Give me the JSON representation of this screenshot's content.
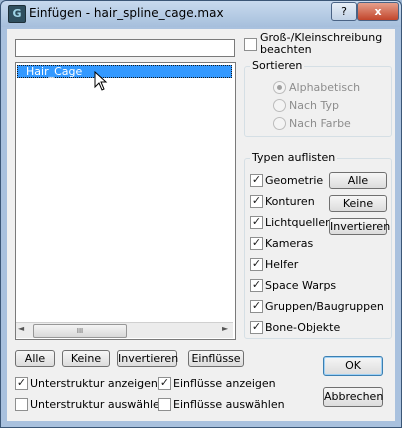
{
  "window": {
    "title": "Einfügen - hair_spline_cage.max"
  },
  "titlebar": {
    "help_label": "?",
    "close_label": "x"
  },
  "search": {
    "value": ""
  },
  "case_sensitive": {
    "label": "Groß-/Kleinschreibung beachten",
    "checked": false
  },
  "list": {
    "items": [
      {
        "label": "Hair_Cage",
        "selected": true
      }
    ]
  },
  "scrollbar": {
    "left_label": "◄",
    "right_label": "►",
    "thumb_label": "III"
  },
  "sort": {
    "title": "Sortieren",
    "options": [
      {
        "label": "Alphabetisch",
        "selected": true
      },
      {
        "label": "Nach Typ",
        "selected": false
      },
      {
        "label": "Nach Farbe",
        "selected": false
      }
    ]
  },
  "types": {
    "title": "Typen auflisten",
    "items": [
      {
        "label": "Geometrie",
        "checked": true
      },
      {
        "label": "Konturen",
        "checked": true
      },
      {
        "label": "Lichtquellen",
        "checked": true
      },
      {
        "label": "Kameras",
        "checked": true
      },
      {
        "label": "Helfer",
        "checked": true
      },
      {
        "label": "Space Warps",
        "checked": true
      },
      {
        "label": "Gruppen/Baugruppen",
        "checked": true
      },
      {
        "label": "Bone-Objekte",
        "checked": true
      }
    ],
    "all_label": "Alle",
    "none_label": "Keine",
    "invert_label": "Invertieren"
  },
  "bottom_buttons": {
    "all_label": "Alle",
    "none_label": "Keine",
    "invert_label": "Invertieren",
    "influences_label": "Einflüsse"
  },
  "options": {
    "show_substructure": {
      "label": "Unterstruktur anzeigen",
      "checked": true
    },
    "show_influences": {
      "label": "Einflüsse anzeigen",
      "checked": true
    },
    "select_substructure": {
      "label": "Unterstruktur auswählen",
      "checked": false
    },
    "select_influences": {
      "label": "Einflüsse auswählen",
      "checked": false
    }
  },
  "dialog": {
    "ok_label": "OK",
    "cancel_label": "Abbrechen"
  },
  "check_glyph": "✓"
}
